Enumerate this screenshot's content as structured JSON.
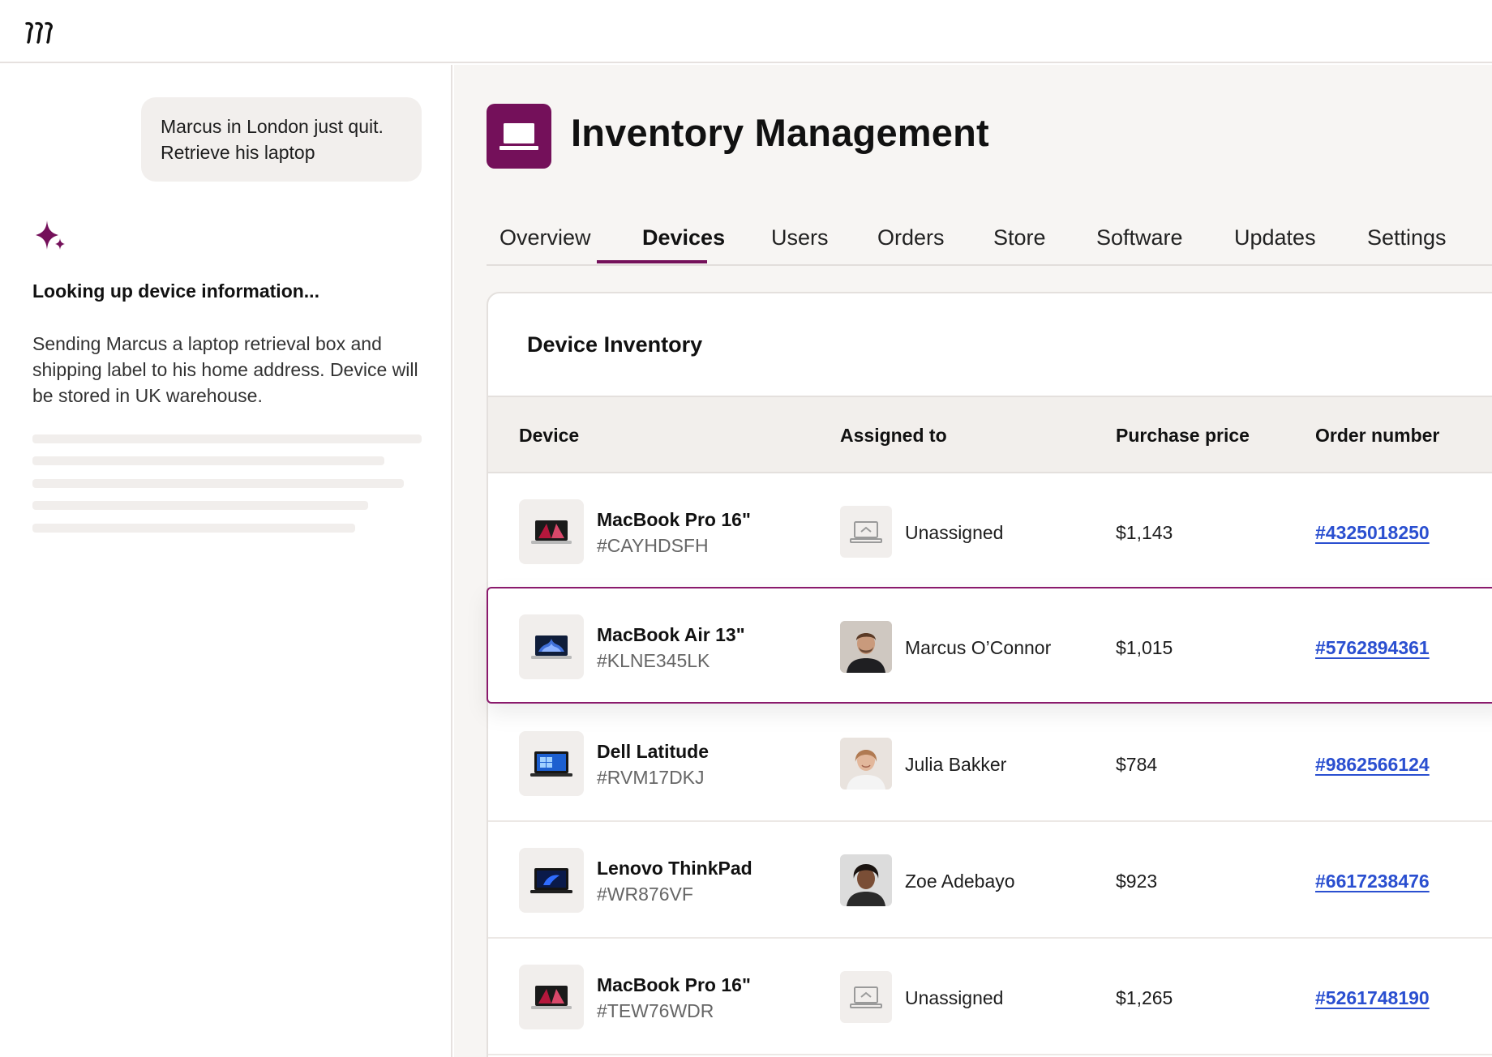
{
  "chat": {
    "user_message": "Marcus in London just quit.\nRetrieve his laptop",
    "status_title": "Looking up device information...",
    "status_body": "Sending Marcus a laptop retrieval box and shipping label to his home address. Device will be stored in UK warehouse."
  },
  "app": {
    "title": "Inventory Management",
    "icon": "laptop-icon",
    "accent_color": "#74105a",
    "link_color": "#2a4fd0"
  },
  "tabs": [
    {
      "label": "Overview"
    },
    {
      "label": "Devices",
      "active": true
    },
    {
      "label": "Users"
    },
    {
      "label": "Orders"
    },
    {
      "label": "Store"
    },
    {
      "label": "Software"
    },
    {
      "label": "Updates"
    },
    {
      "label": "Settings"
    }
  ],
  "inventory": {
    "title": "Device Inventory",
    "columns": {
      "device": "Device",
      "assigned_to": "Assigned to",
      "purchase_price": "Purchase price",
      "order_number": "Order number"
    },
    "rows": [
      {
        "device": "MacBook Pro 16\"",
        "serial": "#CAYHDSFH",
        "assignee": "Unassigned",
        "price": "$1,143",
        "order": "#4325018250",
        "device_icon": "macbook-pro-icon",
        "avatar": "unassigned-laptop-icon"
      },
      {
        "device": "MacBook Air 13\"",
        "serial": "#KLNE345LK",
        "assignee": "Marcus O’Connor",
        "price": "$1,015",
        "order": "#5762894361",
        "device_icon": "macbook-air-icon",
        "avatar": "user-avatar",
        "selected": true
      },
      {
        "device": "Dell Latitude",
        "serial": "#RVM17DKJ",
        "assignee": "Julia Bakker",
        "price": "$784",
        "order": "#9862566124",
        "device_icon": "dell-laptop-icon",
        "avatar": "user-avatar"
      },
      {
        "device": "Lenovo ThinkPad",
        "serial": "#WR876VF",
        "assignee": "Zoe Adebayo",
        "price": "$923",
        "order": "#6617238476",
        "device_icon": "thinkpad-icon",
        "avatar": "user-avatar"
      },
      {
        "device": "MacBook Pro 16\"",
        "serial": "#TEW76WDR",
        "assignee": "Unassigned",
        "price": "$1,265",
        "order": "#5261748190",
        "device_icon": "macbook-pro-icon",
        "avatar": "unassigned-laptop-icon"
      }
    ]
  }
}
